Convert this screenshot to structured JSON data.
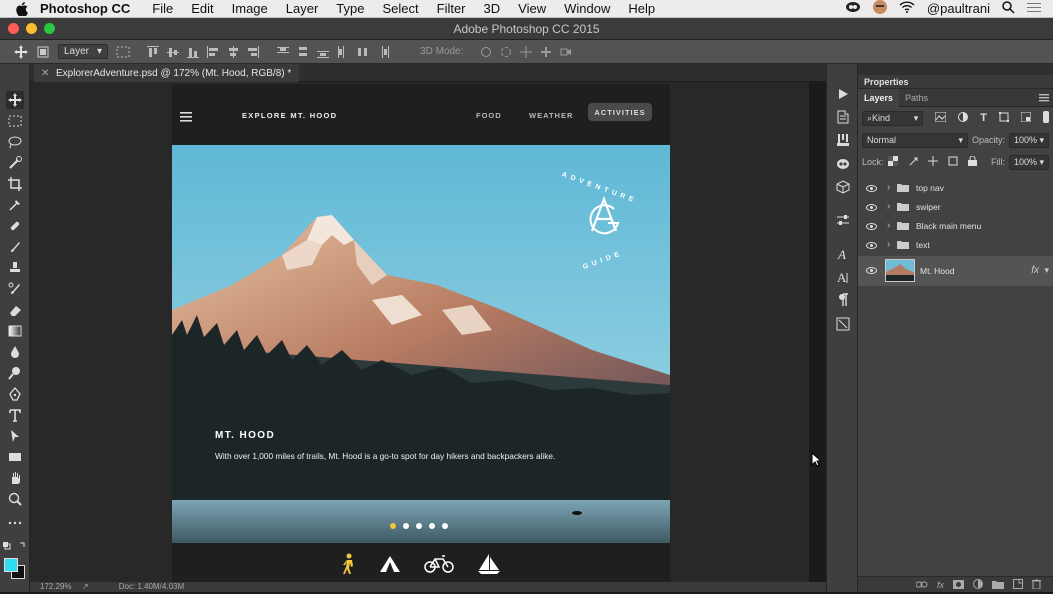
{
  "menubar": {
    "app": "Photoshop CC",
    "items": [
      "File",
      "Edit",
      "Image",
      "Layer",
      "Type",
      "Select",
      "Filter",
      "3D",
      "View",
      "Window",
      "Help"
    ],
    "user": "@paultrani"
  },
  "window": {
    "title": "Adobe Photoshop CC 2015"
  },
  "options_bar": {
    "layer_select": "Layer",
    "mode_label": "3D Mode:"
  },
  "document": {
    "tab_label": "ExplorerAdventure.psd @ 172% (Mt. Hood, RGB/8) *"
  },
  "status": {
    "zoom": "172.29%",
    "doc_size": "Doc: 1.40M/4.03M"
  },
  "artboard": {
    "nav": {
      "brand": "EXPLORE MT. HOOD",
      "links": [
        "FOOD",
        "WEATHER"
      ],
      "active": "ACTIVITIES"
    },
    "hero": {
      "title": "MT. HOOD",
      "description": "With over 1,000 miles of trails, Mt. Hood is a go-to spot for day hikers and backpackers alike.",
      "badge_top": "ADVENTURE",
      "badge_bottom": "GUIDE",
      "slides": 5,
      "active_slide": 1
    },
    "footer_icons": [
      "hiker-icon",
      "tent-icon",
      "bicycle-icon",
      "sailboat-icon"
    ]
  },
  "panel": {
    "title": "Properties",
    "tabs": [
      "Layers",
      "Paths"
    ],
    "filter": "Kind",
    "blend_mode": "Normal",
    "opacity_label": "Opacity:",
    "opacity_value": "100%",
    "lock_label": "Lock:",
    "fill_label": "Fill:",
    "fill_value": "100%",
    "layers": [
      {
        "name": "top nav"
      },
      {
        "name": "swiper"
      },
      {
        "name": "Black main menu"
      },
      {
        "name": "text"
      }
    ],
    "selected_layer": {
      "name": "Mt. Hood",
      "fx": "fx"
    }
  },
  "colors": {
    "accent": "#f2c53d",
    "foreground": "#2fdcf2"
  }
}
